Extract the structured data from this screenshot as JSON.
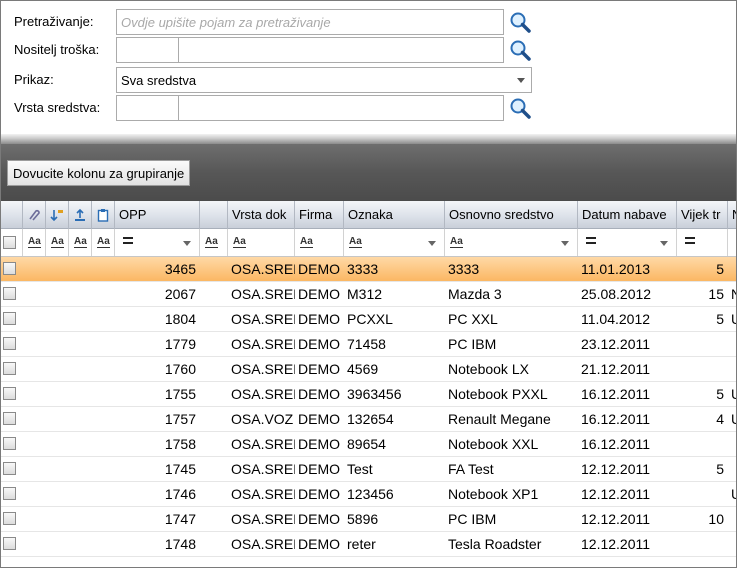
{
  "filters": {
    "search": {
      "label": "Pretraživanje:",
      "placeholder": "Ovdje upišite pojam za pretraživanje"
    },
    "cost_holder": {
      "label": "Nositelj troška:"
    },
    "display": {
      "label": "Prikaz:",
      "value": "Sva sredstva"
    },
    "asset_type": {
      "label": "Vrsta sredstva:"
    }
  },
  "group_bar": {
    "label": "Dovucite kolonu za grupiranje"
  },
  "grid": {
    "columns": {
      "opp": "OPP",
      "doc_type": "Vrsta dok",
      "company": "Firma",
      "code": "Oznaka",
      "asset": "Osnovno sredstvo",
      "purchase_date": "Datum nabave",
      "screw": "Vijek tr",
      "more": "N"
    },
    "filter_symbol": "Aa",
    "rows": [
      {
        "opp": "3465",
        "doc_type": "OSA.SRED",
        "company": "DEMO",
        "code": "3333",
        "asset": "3333",
        "date": "11.01.2013",
        "life": "5",
        "extra": "",
        "selected": true
      },
      {
        "opp": "2067",
        "doc_type": "OSA.SRED",
        "company": "DEMO",
        "code": "M312",
        "asset": "Mazda 3",
        "date": "25.08.2012",
        "life": "15",
        "extra": "N"
      },
      {
        "opp": "1804",
        "doc_type": "OSA.SRED",
        "company": "DEMO",
        "code": "PCXXL",
        "asset": "PC XXL",
        "date": "11.04.2012",
        "life": "5",
        "extra": "U"
      },
      {
        "opp": "1779",
        "doc_type": "OSA.SRED",
        "company": "DEMO",
        "code": "71458",
        "asset": "PC IBM",
        "date": "23.12.2011",
        "life": "",
        "extra": ""
      },
      {
        "opp": "1760",
        "doc_type": "OSA.SRED",
        "company": "DEMO",
        "code": "4569",
        "asset": "Notebook LX",
        "date": "21.12.2011",
        "life": "",
        "extra": ""
      },
      {
        "opp": "1755",
        "doc_type": "OSA.SRED",
        "company": "DEMO",
        "code": "3963456",
        "asset": "Notebook PXXL",
        "date": "16.12.2011",
        "life": "5",
        "extra": "U"
      },
      {
        "opp": "1757",
        "doc_type": "OSA.VOZ",
        "company": "DEMO",
        "code": "132654",
        "asset": "Renault Megane",
        "date": "16.12.2011",
        "life": "4",
        "extra": "U"
      },
      {
        "opp": "1758",
        "doc_type": "OSA.SRED",
        "company": "DEMO",
        "code": "89654",
        "asset": "Notebook XXL",
        "date": "16.12.2011",
        "life": "",
        "extra": ""
      },
      {
        "opp": "1745",
        "doc_type": "OSA.SRED",
        "company": "DEMO",
        "code": "Test",
        "asset": "FA Test",
        "date": "12.12.2011",
        "life": "5",
        "extra": ""
      },
      {
        "opp": "1746",
        "doc_type": "OSA.SRED",
        "company": "DEMO",
        "code": "123456",
        "asset": "Notebook XP1",
        "date": "12.12.2011",
        "life": "",
        "extra": "U"
      },
      {
        "opp": "1747",
        "doc_type": "OSA.SRED",
        "company": "DEMO",
        "code": "5896",
        "asset": "PC IBM",
        "date": "12.12.2011",
        "life": "10",
        "extra": ""
      },
      {
        "opp": "1748",
        "doc_type": "OSA.SRED",
        "company": "DEMO",
        "code": "reter",
        "asset": "Tesla Roadster",
        "date": "12.12.2011",
        "life": "",
        "extra": ""
      }
    ]
  },
  "colors": {
    "selected_row": "#fbb763",
    "header_band": "#575757"
  },
  "icons": [
    "search-icon",
    "attachment-icon",
    "sort-icon",
    "upload-icon",
    "clipboard-icon"
  ]
}
